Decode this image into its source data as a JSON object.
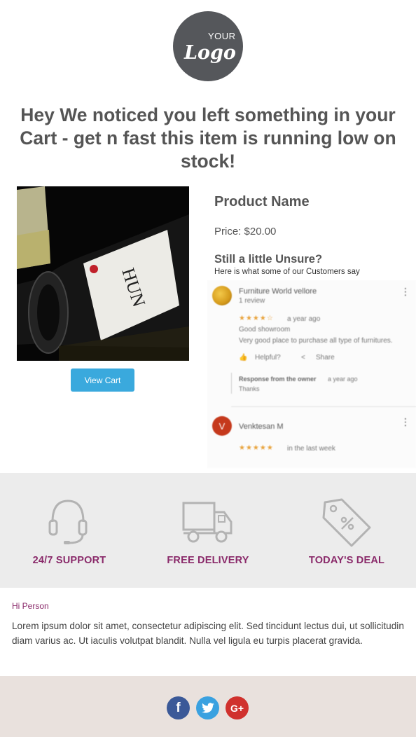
{
  "logo": {
    "top_text": "YOUR",
    "script_text": "Logo"
  },
  "headline": "Hey We noticed you left something in your Cart - get n fast this item is running low on stock!",
  "product": {
    "image_label": "HUN",
    "view_cart_label": "View Cart",
    "name": "Product Name",
    "price": "Price: $20.00"
  },
  "reviews_section": {
    "title": "Still a little Unsure?",
    "subtitle": "Here is what some of our Customers say",
    "review1": {
      "name": "Furniture World vellore",
      "count": "1 review",
      "stars": "★★★★☆",
      "time": "a year ago",
      "line1": "Good showroom",
      "line2": "Very good place to purchase all type of furnitures.",
      "helpful": "Helpful?",
      "share": "Share",
      "response_label": "Response from the owner",
      "response_time": "a year ago",
      "response_text": "Thanks"
    },
    "review2": {
      "avatar_letter": "V",
      "name": "Venktesan M",
      "stars": "★★★★★",
      "time": "in the last week"
    }
  },
  "features": [
    {
      "label": "24/7 SUPPORT",
      "icon": "headset-icon"
    },
    {
      "label": "FREE DELIVERY",
      "icon": "truck-icon"
    },
    {
      "label": "TODAY'S DEAL",
      "icon": "price-tag-icon"
    }
  ],
  "greeting": "Hi Person",
  "body": "Lorem ipsum dolor sit amet, consectetur adipiscing elit. Sed tincidunt lectus dui, ut sollicitudin diam varius ac. Ut iaculis volutpat blandit. Nulla vel ligula eu turpis placerat gravida.",
  "social": [
    {
      "name": "facebook",
      "glyph": "f",
      "color": "#3b5998"
    },
    {
      "name": "twitter",
      "glyph": "t",
      "color": "#3aa1e0"
    },
    {
      "name": "google-plus",
      "glyph": "G+",
      "color": "#d0312d"
    }
  ],
  "colors": {
    "accent": "#8a2a6a",
    "button": "#3aa9dd",
    "logo_bg": "#55575b"
  }
}
